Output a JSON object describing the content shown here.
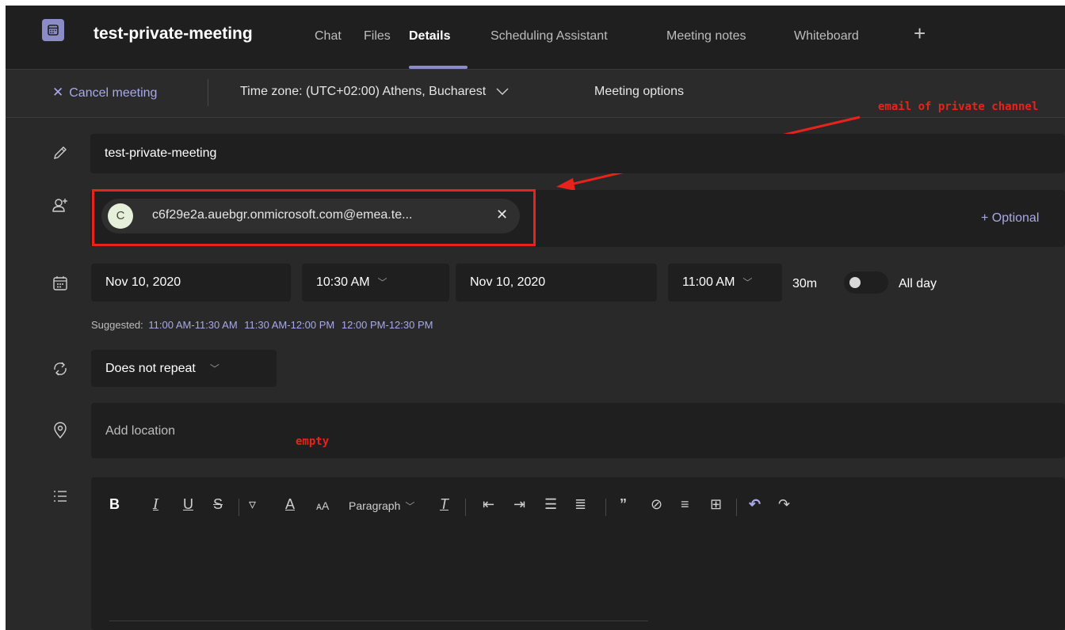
{
  "header": {
    "title": "test-private-meeting",
    "tabs": [
      {
        "label": "Chat"
      },
      {
        "label": "Files"
      },
      {
        "label": "Details"
      },
      {
        "label": "Scheduling Assistant"
      },
      {
        "label": "Meeting notes"
      },
      {
        "label": "Whiteboard"
      }
    ],
    "add_tab": "+"
  },
  "toolbar": {
    "cancel_label": "Cancel meeting",
    "timezone_label": "Time zone: (UTC+02:00) Athens, Bucharest",
    "options_label": "Meeting options"
  },
  "form": {
    "title_value": "test-private-meeting",
    "attendee": {
      "initial": "C",
      "email": "c6f29e2a.auebgr.onmicrosoft.com@emea.te..."
    },
    "optional_label": "+ Optional",
    "start_date": "Nov 10, 2020",
    "start_time": "10:30 AM",
    "end_date": "Nov 10, 2020",
    "end_time": "11:00 AM",
    "duration": "30m",
    "all_day_label": "All day",
    "suggested_label": "Suggested:",
    "suggested_times": [
      "11:00 AM-11:30 AM",
      "11:30 AM-12:00 PM",
      "12:00 PM-12:30 PM"
    ],
    "repeat_value": "Does not repeat",
    "location_placeholder": "Add location"
  },
  "editor": {
    "paragraph_label": "Paragraph"
  },
  "annotations": {
    "email_note": "email of private channel",
    "empty_note": "empty"
  },
  "colors": {
    "accent": "#a8a9e8",
    "annotation": "#e8231b"
  }
}
